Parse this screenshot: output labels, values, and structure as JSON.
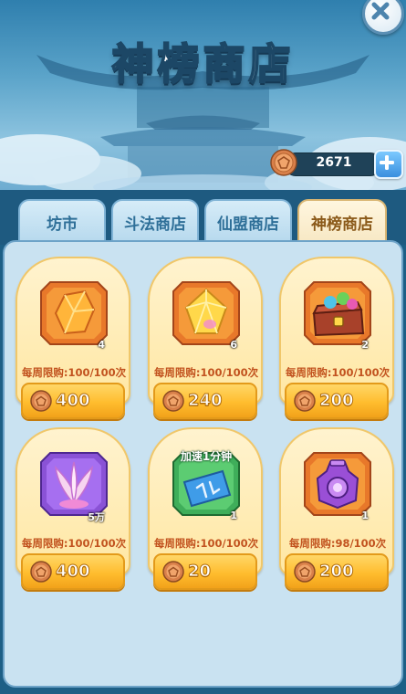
{
  "title": "神榜商店",
  "currency": {
    "amount": "2671",
    "icon": "copper-coin-icon",
    "add_icon": "plus-icon"
  },
  "close_icon": "close-icon",
  "tabs": [
    {
      "label": "坊市",
      "active": false
    },
    {
      "label": "斗法商店",
      "active": false
    },
    {
      "label": "仙盟商店",
      "active": false
    },
    {
      "label": "神榜商店",
      "active": true
    }
  ],
  "items": [
    {
      "icon": "orange-crystal-icon",
      "qty": "4",
      "limit": "每周限购:100/100次",
      "price": "400"
    },
    {
      "icon": "golden-gem-icon",
      "qty": "6",
      "limit": "每周限购:100/100次",
      "price": "240"
    },
    {
      "icon": "treasure-chest-icon",
      "qty": "2",
      "limit": "每周限购:100/100次",
      "price": "200"
    },
    {
      "icon": "purple-spirit-herb-icon",
      "qty": "5万",
      "limit": "每周限购:100/100次",
      "price": "400"
    },
    {
      "icon": "speedup-ticket-icon",
      "overlay": "加速1分钟",
      "qty": "1",
      "limit": "每周限购:100/100次",
      "price": "20"
    },
    {
      "icon": "purple-pouch-icon",
      "qty": "1",
      "limit": "每周限购:98/100次",
      "price": "200"
    }
  ],
  "colors": {
    "limit_text": "#c2531f",
    "price_button": "#ffbd2e",
    "panel": "#c9e2f1"
  }
}
